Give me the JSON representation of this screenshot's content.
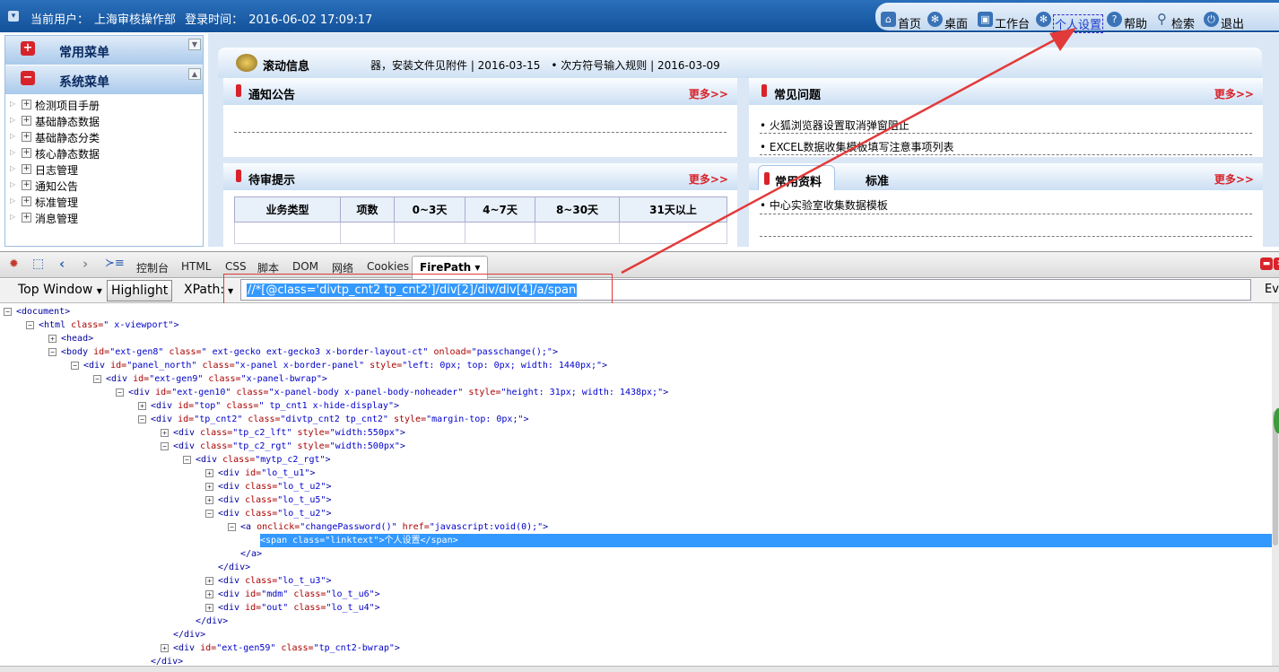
{
  "topbar": {
    "user_label": "当前用户：",
    "user": "上海审核操作部",
    "login_label": "登录时间：",
    "login_time": "2016-06-02 17:09:17",
    "nav": [
      {
        "label": "首页",
        "icon": "home-icon"
      },
      {
        "label": "桌面",
        "icon": "desktop-icon"
      },
      {
        "label": "工作台",
        "icon": "workbench-icon"
      },
      {
        "label": "个人设置",
        "icon": "settings-icon"
      },
      {
        "label": "帮助",
        "icon": "help-icon"
      },
      {
        "label": "检索",
        "icon": "search-icon"
      },
      {
        "label": "退出",
        "icon": "power-icon"
      }
    ]
  },
  "sidebar": {
    "common_menu": "常用菜单",
    "system_menu": "系统菜单",
    "items": [
      "检测项目手册",
      "基础静态数据",
      "基础静态分类",
      "核心静态数据",
      "日志管理",
      "通知公告",
      "标准管理",
      "消息管理"
    ]
  },
  "scroll": {
    "title": "滚动信息",
    "text": "器，安装文件见附件 | 2016-03-15　• 次方符号输入规则 | 2016-03-09"
  },
  "notice": {
    "title": "通知公告",
    "more": "更多>>"
  },
  "faq": {
    "title": "常见问题",
    "more": "更多>>",
    "items": [
      "• 火狐浏览器设置取消弹窗阻止",
      "• EXCEL数据收集模板填写注意事项列表"
    ]
  },
  "pending": {
    "title": "待审提示",
    "more": "更多>>",
    "headers": [
      "业务类型",
      "项数",
      "0~3天",
      "4~7天",
      "8~30天",
      "31天以上"
    ]
  },
  "resources": {
    "tab1": "常用资料",
    "tab2": "标准",
    "more": "更多>>",
    "items": [
      "• 中心实验室收集数据模板"
    ]
  },
  "firebug": {
    "tabs": [
      "控制台",
      "HTML",
      "CSS",
      "脚本",
      "DOM",
      "网络",
      "Cookies"
    ],
    "active_tab": "FirePath ▾",
    "top_window": "Top Window",
    "highlight": "Highlight",
    "xpath_label": "XPath:",
    "xpath": "//*[@class='divtp_cnt2 tp_cnt2']/div[2]/div/div[4]/a/span",
    "eval": "Eva"
  },
  "dom": [
    {
      "indent": 0,
      "tog": "−",
      "html": "<document>"
    },
    {
      "indent": 1,
      "tog": "−",
      "tag": "html",
      "attrs": [
        [
          "class",
          " x-viewport"
        ]
      ]
    },
    {
      "indent": 2,
      "tog": "+",
      "tag": "head",
      "attrs": []
    },
    {
      "indent": 2,
      "tog": "−",
      "tag": "body",
      "attrs": [
        [
          "id",
          "ext-gen8"
        ],
        [
          "class",
          " ext-gecko ext-gecko3 x-border-layout-ct"
        ],
        [
          "onload",
          "passchange();"
        ]
      ]
    },
    {
      "indent": 3,
      "tog": "−",
      "tag": "div",
      "attrs": [
        [
          "id",
          "panel_north"
        ],
        [
          "class",
          "x-panel x-border-panel"
        ],
        [
          "style",
          "left: 0px; top: 0px; width: 1440px;"
        ]
      ]
    },
    {
      "indent": 4,
      "tog": "−",
      "tag": "div",
      "attrs": [
        [
          "id",
          "ext-gen9"
        ],
        [
          "class",
          "x-panel-bwrap"
        ]
      ]
    },
    {
      "indent": 5,
      "tog": "−",
      "tag": "div",
      "attrs": [
        [
          "id",
          "ext-gen10"
        ],
        [
          "class",
          "x-panel-body x-panel-body-noheader"
        ],
        [
          "style",
          "height: 31px; width: 1438px;"
        ]
      ]
    },
    {
      "indent": 6,
      "tog": "+",
      "tag": "div",
      "attrs": [
        [
          "id",
          "top"
        ],
        [
          "class",
          " tp_cnt1 x-hide-display"
        ]
      ]
    },
    {
      "indent": 6,
      "tog": "−",
      "tag": "div",
      "attrs": [
        [
          "id",
          "tp_cnt2"
        ],
        [
          "class",
          "divtp_cnt2 tp_cnt2"
        ],
        [
          "style",
          "margin-top: 0px;"
        ]
      ]
    },
    {
      "indent": 7,
      "tog": "+",
      "tag": "div",
      "attrs": [
        [
          "class",
          "tp_c2_lft"
        ],
        [
          "style",
          "width:550px"
        ]
      ]
    },
    {
      "indent": 7,
      "tog": "−",
      "tag": "div",
      "attrs": [
        [
          "class",
          "tp_c2_rgt"
        ],
        [
          "style",
          "width:500px"
        ]
      ]
    },
    {
      "indent": 8,
      "tog": "−",
      "tag": "div",
      "attrs": [
        [
          "class",
          "mytp_c2_rgt"
        ]
      ]
    },
    {
      "indent": 9,
      "tog": "+",
      "tag": "div",
      "attrs": [
        [
          "id",
          "lo_t_u1"
        ]
      ]
    },
    {
      "indent": 9,
      "tog": "+",
      "tag": "div",
      "attrs": [
        [
          "class",
          "lo_t_u2"
        ]
      ]
    },
    {
      "indent": 9,
      "tog": "+",
      "tag": "div",
      "attrs": [
        [
          "class",
          "lo_t_u5"
        ]
      ]
    },
    {
      "indent": 9,
      "tog": "−",
      "tag": "div",
      "attrs": [
        [
          "class",
          "lo_t_u2"
        ]
      ]
    },
    {
      "indent": 10,
      "tog": "−",
      "tag": "a",
      "attrs": [
        [
          "onclick",
          "changePassword()"
        ],
        [
          "href",
          "javascript:void(0);"
        ]
      ]
    },
    {
      "indent": 11,
      "tog": "",
      "sel": true,
      "html": "<span class=\"linktext\">个人设置</span>"
    },
    {
      "indent": 10,
      "tog": "",
      "html": "</a>"
    },
    {
      "indent": 9,
      "tog": "",
      "html": "</div>"
    },
    {
      "indent": 9,
      "tog": "+",
      "tag": "div",
      "attrs": [
        [
          "class",
          "lo_t_u3"
        ]
      ]
    },
    {
      "indent": 9,
      "tog": "+",
      "tag": "div",
      "attrs": [
        [
          "id",
          "mdm"
        ],
        [
          "class",
          "lo_t_u6"
        ]
      ]
    },
    {
      "indent": 9,
      "tog": "+",
      "tag": "div",
      "attrs": [
        [
          "id",
          "out"
        ],
        [
          "class",
          "lo_t_u4"
        ]
      ]
    },
    {
      "indent": 8,
      "tog": "",
      "html": "</div>"
    },
    {
      "indent": 7,
      "tog": "",
      "html": "</div>"
    },
    {
      "indent": 7,
      "tog": "+",
      "tag": "div",
      "attrs": [
        [
          "id",
          "ext-gen59"
        ],
        [
          "class",
          "tp_cnt2-bwrap"
        ]
      ]
    },
    {
      "indent": 6,
      "tog": "",
      "html": "</div>"
    }
  ],
  "colors": {
    "accent_red": "#d8232a",
    "header_blue": "#12519a",
    "selection": "#3399ff",
    "annotation": "#e23a3a"
  }
}
